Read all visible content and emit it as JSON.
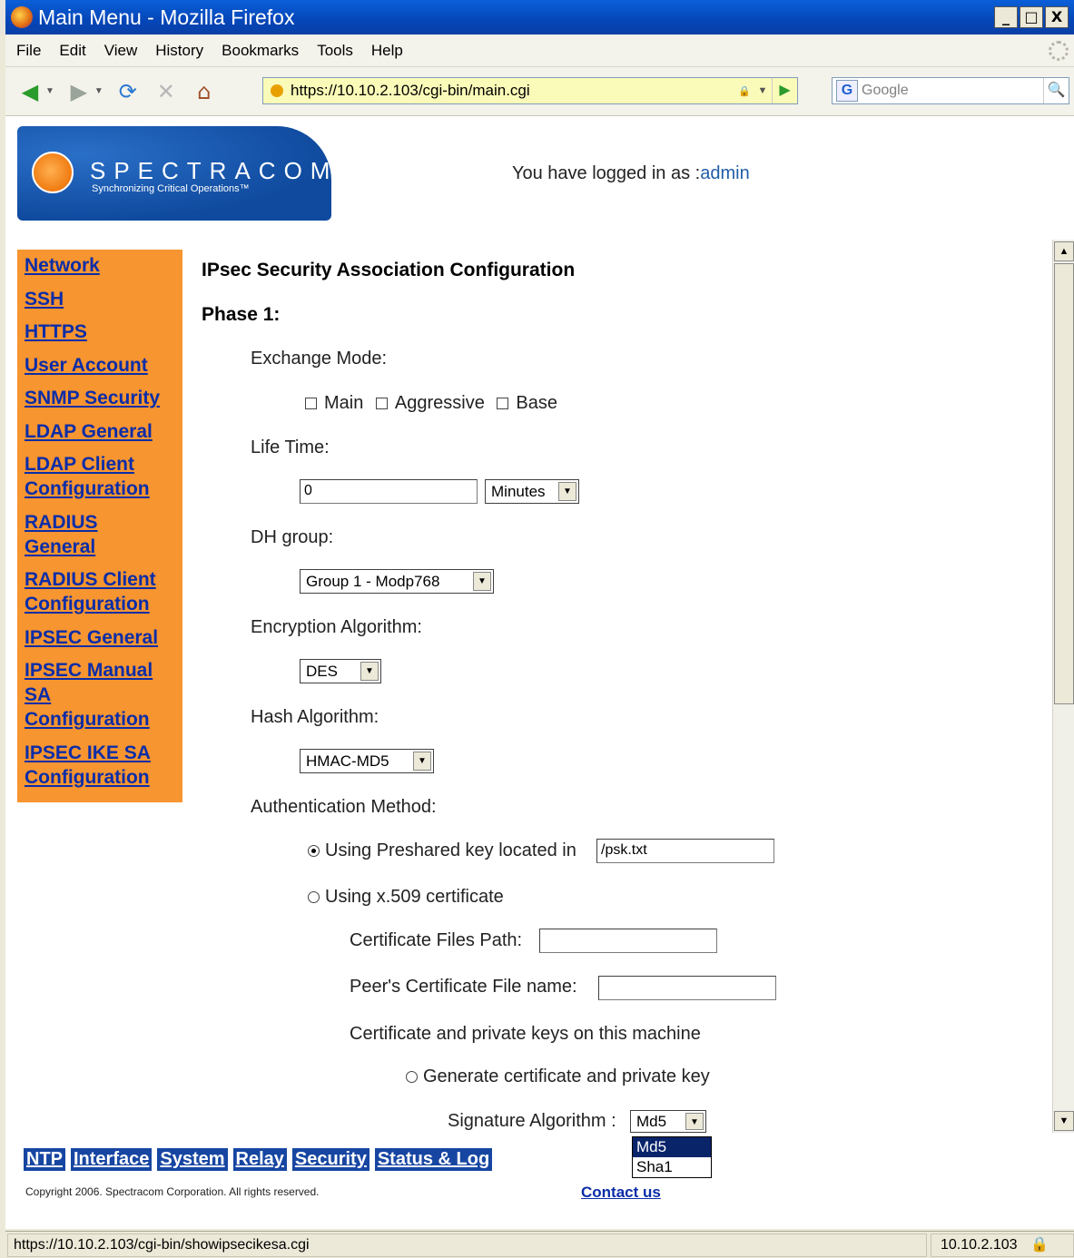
{
  "window": {
    "title": "Main Menu - Mozilla Firefox",
    "controls": [
      "_",
      "□",
      "X"
    ]
  },
  "menubar": [
    "File",
    "Edit",
    "View",
    "History",
    "Bookmarks",
    "Tools",
    "Help"
  ],
  "toolbar": {
    "url": "https://10.10.2.103/cgi-bin/main.cgi",
    "search_placeholder": "Google"
  },
  "header": {
    "logo_brand": "SPECTRACOM",
    "logo_tagline": "Synchronizing Critical Operations™",
    "logged_in_prefix": "You have logged in as :",
    "logged_in_user": "admin"
  },
  "sidebar": {
    "items": [
      "Network",
      "SSH",
      "HTTPS",
      "User Account",
      "SNMP Security",
      "LDAP General",
      "LDAP Client Configuration",
      "RADIUS General",
      "RADIUS Client Configuration",
      "IPSEC General",
      "IPSEC Manual SA Configuration",
      "IPSEC IKE SA Configuration"
    ]
  },
  "form": {
    "title": "IPsec Security Association Configuration",
    "phase": "Phase 1:",
    "exchange_mode_label": "Exchange Mode:",
    "exchange_modes": [
      "Main",
      "Aggressive",
      "Base"
    ],
    "life_time_label": "Life Time:",
    "life_time_value": "0",
    "life_time_unit": "Minutes",
    "dh_group_label": "DH group:",
    "dh_group_value": "Group 1 - Modp768",
    "encryption_label": "Encryption Algorithm:",
    "encryption_value": "DES",
    "hash_label": "Hash Algorithm:",
    "hash_value": "HMAC-MD5",
    "auth_label": "Authentication Method:",
    "auth_preshared_label": "Using Preshared key located in",
    "auth_preshared_path": "/psk.txt",
    "auth_x509_label": "Using x.509 certificate",
    "cert_path_label": "Certificate Files Path:",
    "peer_cert_label": "Peer's Certificate File name:",
    "cert_keys_label": "Certificate and private keys on this machine",
    "generate_label": "Generate certificate and private key",
    "sig_alg_label": "Signature Algorithm :",
    "sig_alg_value": "Md5",
    "sig_alg_options": [
      "Md5",
      "Sha1"
    ]
  },
  "footer": {
    "links": [
      "NTP",
      "Interface",
      "System",
      "Relay",
      "Security",
      "Status & Log"
    ],
    "copyright": "Copyright 2006. Spectracom Corporation. All rights reserved.",
    "contact": "Contact us"
  },
  "statusbar": {
    "url": "https://10.10.2.103/cgi-bin/showipsecikesa.cgi",
    "host": "10.10.2.103"
  },
  "colors": {
    "sidebar_bg": "#f79530",
    "link": "#0b2da8",
    "footer_link_bg": "#1746a2",
    "url_bar_bg": "#fbfbb9"
  }
}
